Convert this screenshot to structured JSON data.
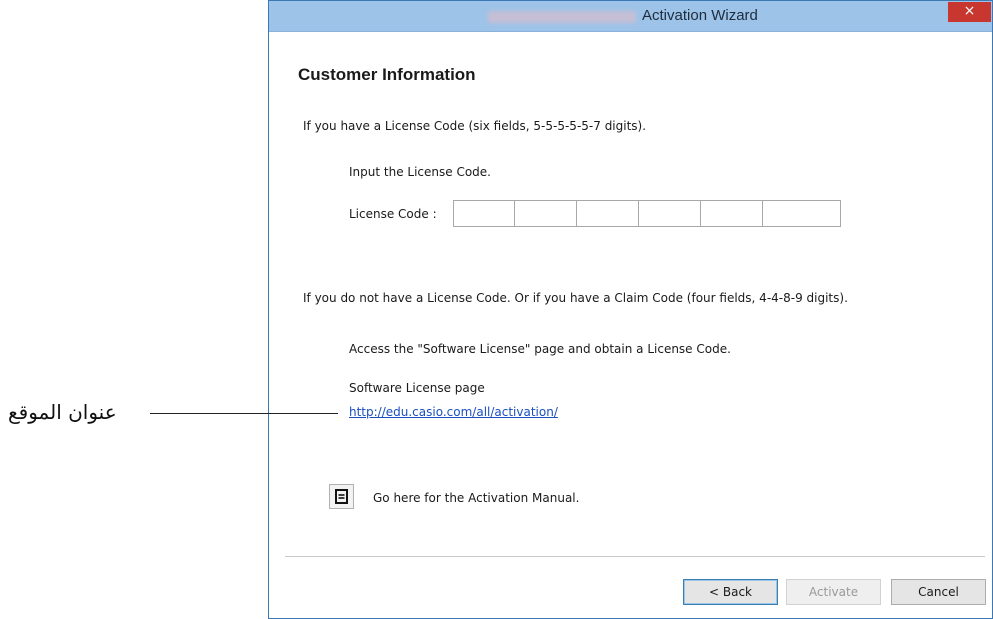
{
  "window": {
    "title": "Activation Wizard",
    "close_glyph": "×"
  },
  "content": {
    "heading": "Customer Information",
    "license_intro": "If you have a License Code (six fields, 5-5-5-5-5-7 digits).",
    "input_instruction": "Input the License Code.",
    "license_code_label": "License Code :",
    "license_code_fields": [
      "",
      "",
      "",
      "",
      "",
      ""
    ],
    "no_license_intro": "If you do not have a License Code. Or if you have a Claim Code (four fields, 4-4-8-9 digits).",
    "access_instruction": "Access the \"Software License\" page and obtain a License Code.",
    "software_license_label": "Software License page",
    "software_license_url": "http://edu.casio.com/all/activation/",
    "manual_text": "Go here for the Activation Manual.",
    "manual_icon": "document-icon"
  },
  "buttons": {
    "back": "< Back",
    "activate": "Activate",
    "cancel": "Cancel"
  },
  "annotation": {
    "label": "عنوان الموقع"
  }
}
